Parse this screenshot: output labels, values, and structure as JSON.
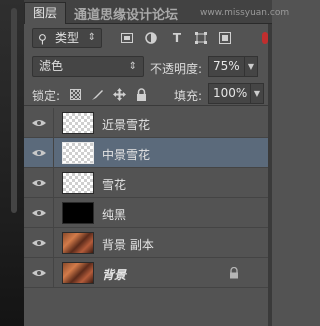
{
  "panel": {
    "tab_label": "图层",
    "watermark_text": "通道思缘设计论坛",
    "watermark_url": "www.missyuan.com"
  },
  "filter": {
    "kind_label": "类型",
    "icons": [
      "image-filter-icon",
      "adjustment-filter-icon",
      "type-filter-icon",
      "shape-filter-icon",
      "smart-object-filter-icon"
    ]
  },
  "blend": {
    "mode": "滤色",
    "opacity_label": "不透明度:",
    "opacity_value": "75%"
  },
  "lock": {
    "label": "锁定:",
    "fill_label": "填充:",
    "fill_value": "100%"
  },
  "layers": [
    {
      "name": "近景雪花",
      "thumb": "transparent",
      "selected": false,
      "locked": false
    },
    {
      "name": "中景雪花",
      "thumb": "transparent",
      "selected": true,
      "locked": false
    },
    {
      "name": "雪花",
      "thumb": "transparent",
      "selected": false,
      "locked": false
    },
    {
      "name": "纯黑",
      "thumb": "black",
      "selected": false,
      "locked": false
    },
    {
      "name": "背景 副本",
      "thumb": "photo",
      "selected": false,
      "locked": false
    },
    {
      "name": "背景",
      "thumb": "photo",
      "selected": false,
      "locked": true
    }
  ],
  "colors": {
    "panel_bg": "#535353",
    "selected_row": "#5b6a7b",
    "filter_toggle": "#c12e2e"
  }
}
